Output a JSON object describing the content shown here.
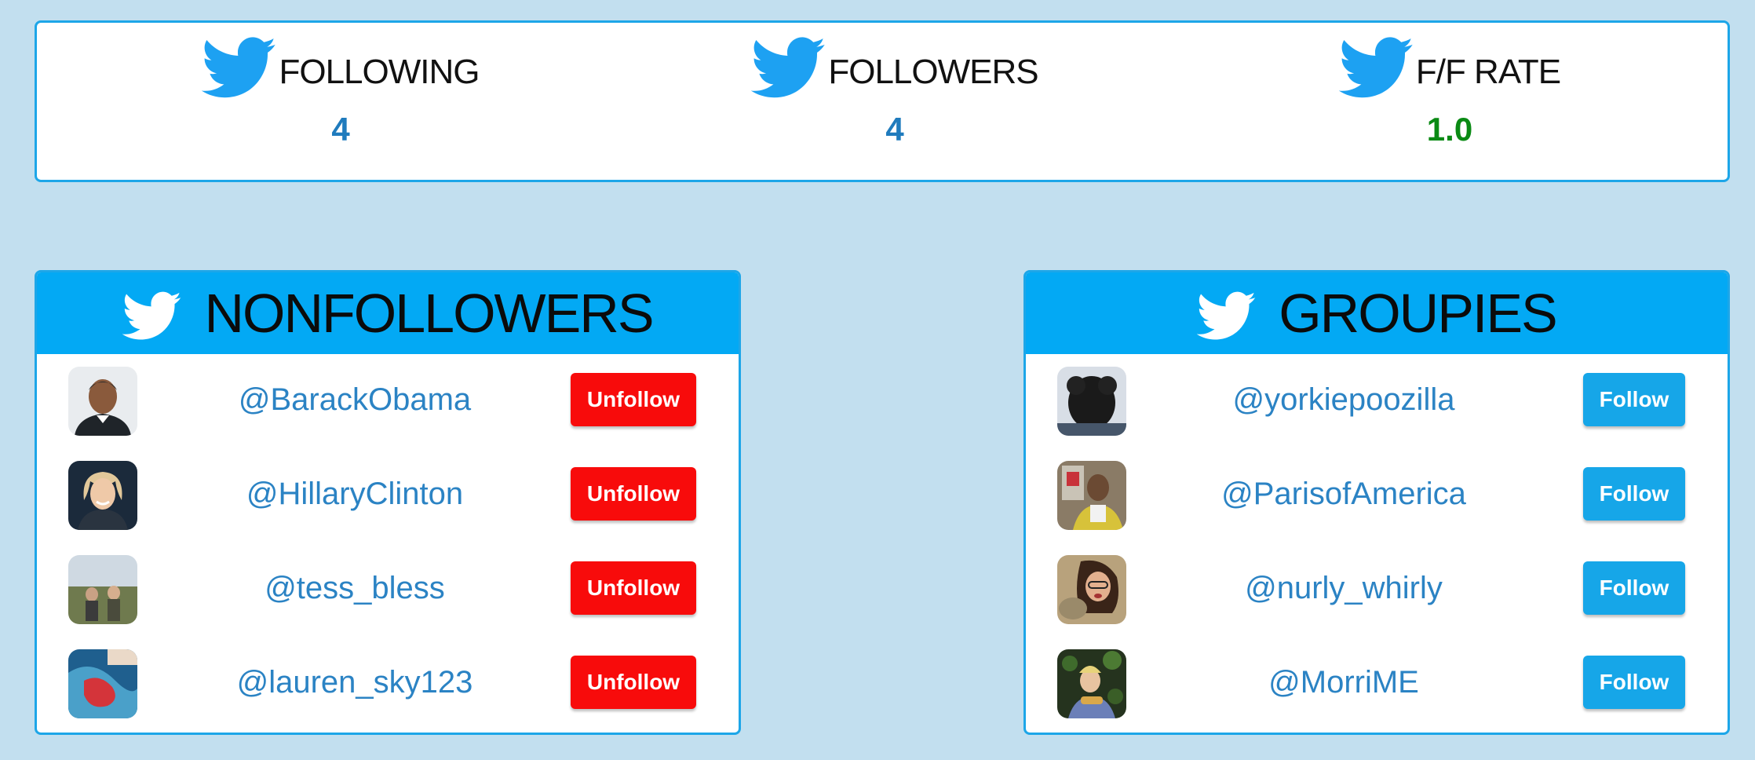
{
  "colors": {
    "background": "#c2dfef",
    "accent": "#03a9f4",
    "border": "#1da6e8",
    "value_blue": "#1f7bbd",
    "value_green": "#0a8a14",
    "unfollow": "#f80b0b",
    "follow": "#16a6e8"
  },
  "stats": [
    {
      "label": "FOLLOWING",
      "value": "4",
      "icon": "twitter-bird-icon"
    },
    {
      "label": "FOLLOWERS",
      "value": "4",
      "icon": "twitter-bird-icon"
    },
    {
      "label": "F/F RATE",
      "value": "1.0",
      "icon": "twitter-bird-icon"
    }
  ],
  "nonfollowers": {
    "title": "NONFOLLOWERS",
    "icon": "twitter-bird-icon",
    "button_label": "Unfollow",
    "users": [
      {
        "handle": "@BarackObama",
        "avatar": "avatar-photo"
      },
      {
        "handle": "@HillaryClinton",
        "avatar": "avatar-photo"
      },
      {
        "handle": "@tess_bless",
        "avatar": "avatar-photo"
      },
      {
        "handle": "@lauren_sky123",
        "avatar": "avatar-photo"
      }
    ]
  },
  "groupies": {
    "title": "GROUPIES",
    "icon": "twitter-bird-icon",
    "button_label": "Follow",
    "users": [
      {
        "handle": "@yorkiepoozilla",
        "avatar": "avatar-photo"
      },
      {
        "handle": "@ParisofAmerica",
        "avatar": "avatar-photo"
      },
      {
        "handle": "@nurly_whirly",
        "avatar": "avatar-photo"
      },
      {
        "handle": "@MorriME",
        "avatar": "avatar-photo"
      }
    ]
  }
}
